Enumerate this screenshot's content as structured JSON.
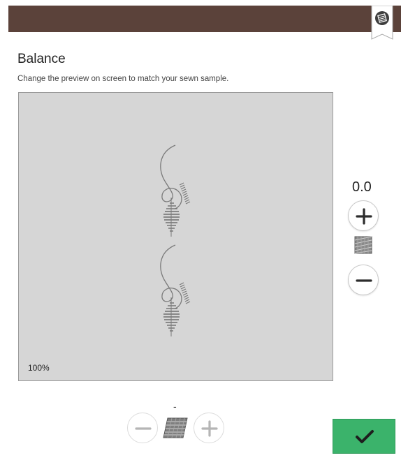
{
  "header": {
    "bookmark_icon": "stitch-info-icon"
  },
  "page": {
    "title": "Balance",
    "subtitle": "Change the preview on screen to match your sewn sample."
  },
  "preview": {
    "zoom_label": "100%"
  },
  "vertical_balance": {
    "value": "0.0",
    "increase_icon": "plus-icon",
    "decrease_icon": "minus-icon",
    "indicator_icon": "vertical-balance-icon"
  },
  "horizontal_balance": {
    "value": "-",
    "increase_icon": "plus-icon",
    "decrease_icon": "minus-icon",
    "indicator_icon": "horizontal-balance-icon"
  },
  "confirm": {
    "icon": "checkmark-icon",
    "color": "#3bb36b"
  }
}
